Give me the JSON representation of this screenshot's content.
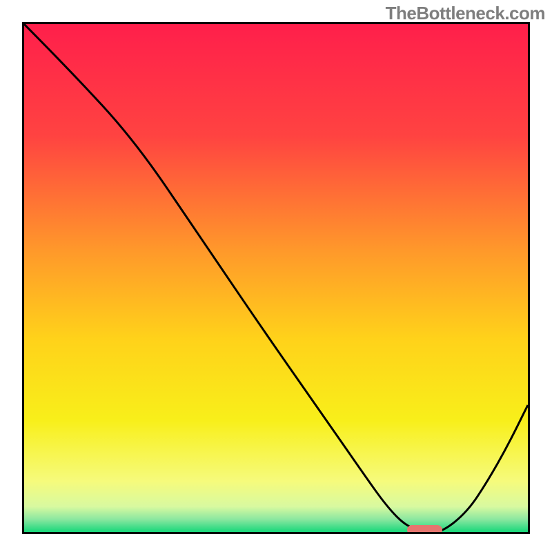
{
  "watermark": "TheBottleneck.com",
  "chart_data": {
    "type": "line",
    "title": "",
    "xlabel": "",
    "ylabel": "",
    "xlim": [
      0,
      100
    ],
    "ylim": [
      0,
      100
    ],
    "grid": false,
    "legend": false,
    "gradient_stops": [
      {
        "offset": 0.0,
        "color": "#ff1f4b"
      },
      {
        "offset": 0.22,
        "color": "#ff4341"
      },
      {
        "offset": 0.45,
        "color": "#ff9a2a"
      },
      {
        "offset": 0.62,
        "color": "#ffd21a"
      },
      {
        "offset": 0.78,
        "color": "#f8ef1a"
      },
      {
        "offset": 0.9,
        "color": "#f6fb7c"
      },
      {
        "offset": 0.95,
        "color": "#d8f9a0"
      },
      {
        "offset": 0.975,
        "color": "#8be7a0"
      },
      {
        "offset": 1.0,
        "color": "#17d77a"
      }
    ],
    "series": [
      {
        "name": "bottleneck-curve",
        "x": [
          0,
          9,
          22,
          35,
          48,
          60,
          67,
          72,
          76,
          80,
          83,
          88,
          92,
          96,
          100
        ],
        "y": [
          100,
          91,
          77,
          58,
          39,
          22,
          12,
          5,
          1,
          0,
          0,
          4,
          10,
          17,
          25
        ]
      }
    ],
    "marker": {
      "name": "optimal-range",
      "x_start": 76,
      "x_end": 83,
      "y": 0,
      "color": "#e6756f"
    }
  }
}
